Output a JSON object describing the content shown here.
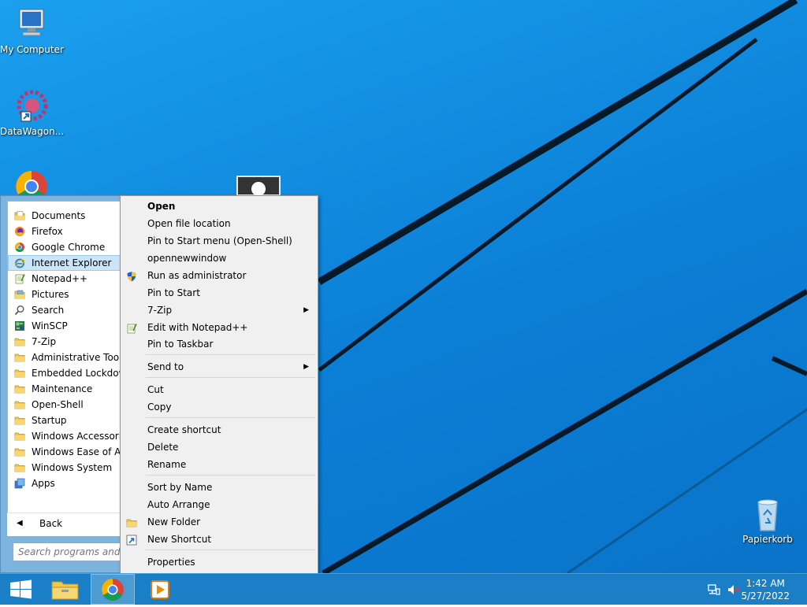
{
  "desktop": {
    "icons": [
      {
        "label": "My Computer",
        "icon": "computer-icon"
      },
      {
        "label": "DataWagon...",
        "icon": "datawagon-icon"
      },
      {
        "label": "",
        "icon": "chrome-icon"
      },
      {
        "label": "Papierkorb",
        "icon": "recycle-bin-icon"
      }
    ]
  },
  "start_menu": {
    "items": [
      {
        "label": "Documents",
        "icon": "documents-icon"
      },
      {
        "label": "Firefox",
        "icon": "firefox-icon"
      },
      {
        "label": "Google Chrome",
        "icon": "chrome-icon"
      },
      {
        "label": "Internet Explorer",
        "icon": "ie-icon"
      },
      {
        "label": "Notepad++",
        "icon": "notepadpp-icon"
      },
      {
        "label": "Pictures",
        "icon": "pictures-icon"
      },
      {
        "label": "Search",
        "icon": "search-icon"
      },
      {
        "label": "WinSCP",
        "icon": "winscp-icon"
      },
      {
        "label": "7-Zip",
        "icon": "folder-icon"
      },
      {
        "label": "Administrative Tools",
        "icon": "folder-icon"
      },
      {
        "label": "Embedded Lockdown",
        "icon": "folder-icon"
      },
      {
        "label": "Maintenance",
        "icon": "folder-icon"
      },
      {
        "label": "Open-Shell",
        "icon": "folder-icon"
      },
      {
        "label": "Startup",
        "icon": "folder-icon"
      },
      {
        "label": "Windows Accessories",
        "icon": "folder-icon"
      },
      {
        "label": "Windows Ease of Acc",
        "icon": "folder-icon"
      },
      {
        "label": "Windows System",
        "icon": "folder-icon"
      },
      {
        "label": "Apps",
        "icon": "apps-icon"
      }
    ],
    "highlighted": "Internet Explorer",
    "back_label": "Back",
    "search_placeholder": "Search programs and file"
  },
  "context_menu": {
    "items": [
      {
        "label": "Open",
        "bold": true
      },
      {
        "label": "Open file location"
      },
      {
        "label": "Pin to Start menu (Open-Shell)"
      },
      {
        "label": "opennewwindow"
      },
      {
        "label": "Run as administrator",
        "icon": "shield-icon"
      },
      {
        "label": "Pin to Start"
      },
      {
        "label": "7-Zip",
        "submenu": true
      },
      {
        "label": "Edit with Notepad++",
        "icon": "notepadpp-icon"
      },
      {
        "label": "Pin to Taskbar"
      },
      {
        "label": "Send to",
        "submenu": true
      },
      {
        "label": "Cut"
      },
      {
        "label": "Copy"
      },
      {
        "label": "Create shortcut"
      },
      {
        "label": "Delete"
      },
      {
        "label": "Rename"
      },
      {
        "label": "Sort by Name"
      },
      {
        "label": "Auto Arrange"
      },
      {
        "label": "New Folder",
        "icon": "folder-icon"
      },
      {
        "label": "New Shortcut",
        "icon": "shortcut-icon"
      },
      {
        "label": "Properties"
      }
    ]
  },
  "taskbar": {
    "buttons": [
      "start-button",
      "file-explorer-icon",
      "chrome-icon",
      "media-player-icon"
    ],
    "active": "chrome-icon",
    "time": "1:42 AM",
    "date": "5/27/2022"
  },
  "colors": {
    "desktop_blue": "#0b7fd6",
    "taskbar": "#1a7fc7",
    "highlight": "#cce4f7"
  }
}
